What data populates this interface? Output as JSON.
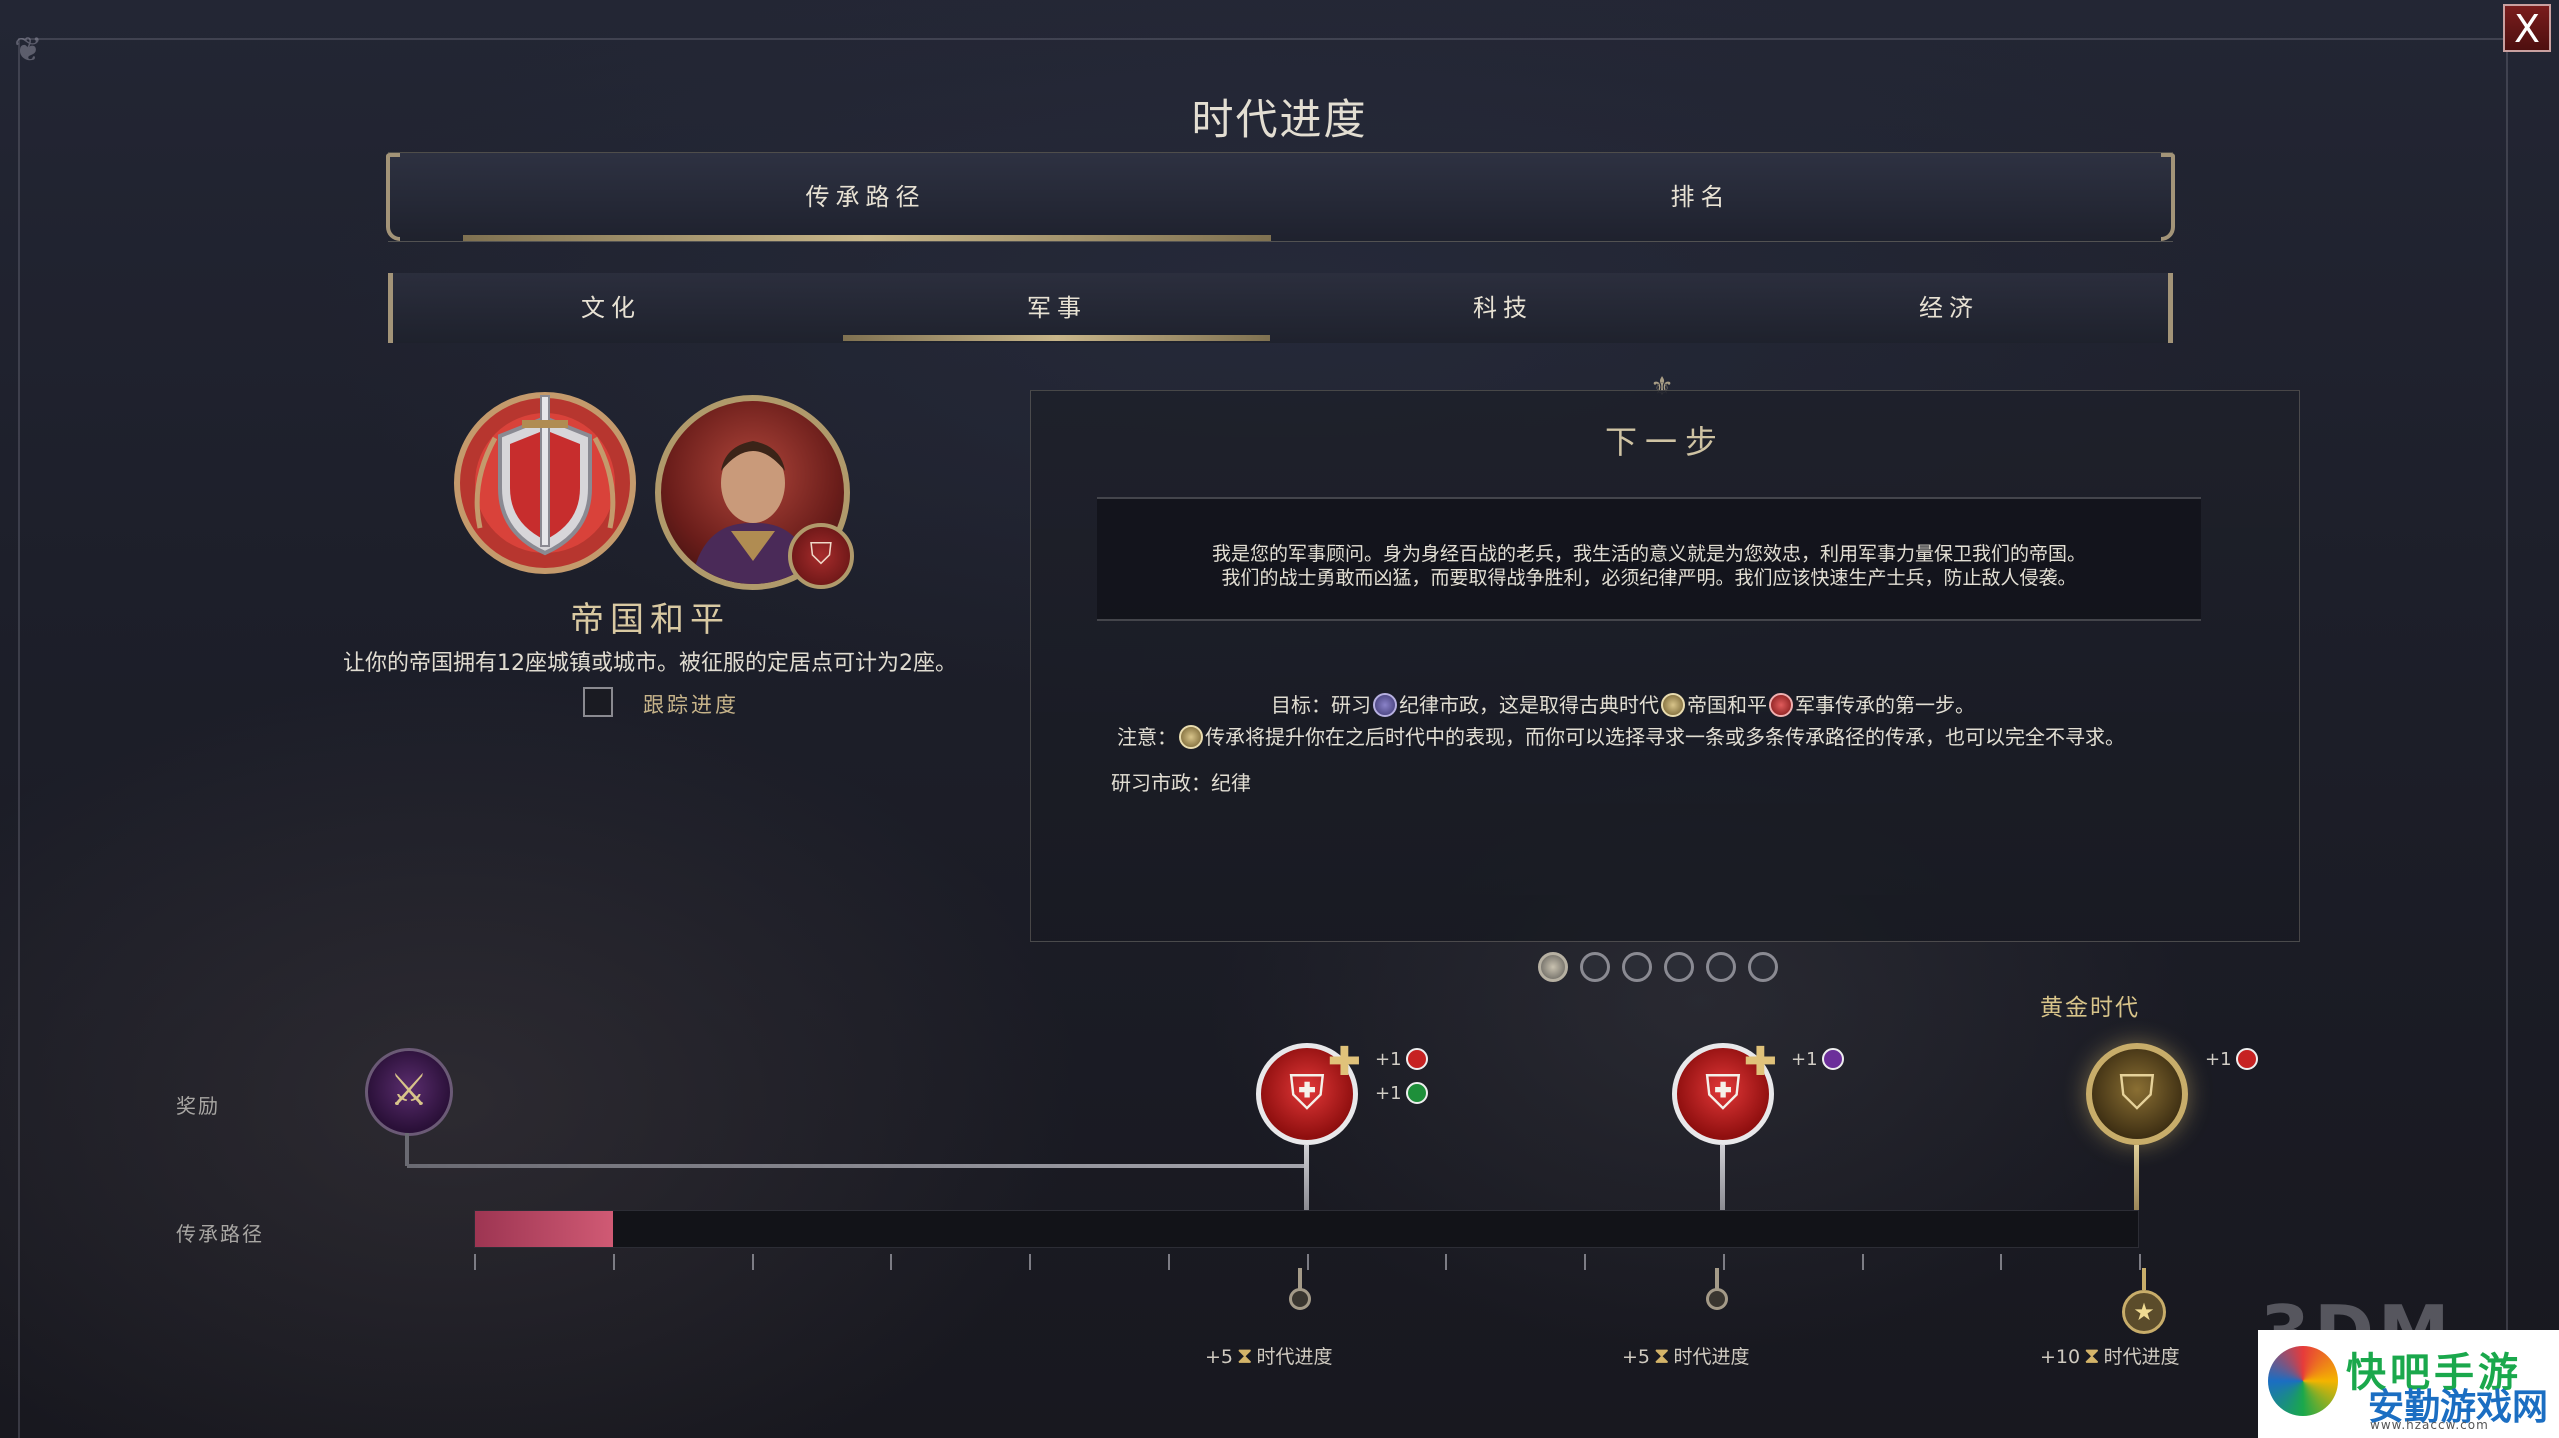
{
  "window": {
    "title": "时代进度",
    "close_label": "X"
  },
  "primary_tabs": [
    {
      "label": "传承路径",
      "active": true
    },
    {
      "label": "排名",
      "active": false
    }
  ],
  "category_tabs": [
    {
      "label": "文化",
      "active": false
    },
    {
      "label": "军事",
      "active": true
    },
    {
      "label": "科技",
      "active": false
    },
    {
      "label": "经济",
      "active": false
    }
  ],
  "legacy": {
    "name": "帝国和平",
    "description": "让你的帝国拥有12座城镇或城市。被征服的定居点可计为2座。",
    "track_label": "跟踪进度",
    "tracked": false
  },
  "next_step": {
    "title": "下一步",
    "quote_line1": "我是您的军事顾问。身为身经百战的老兵，我生活的意义就是为您效忠，利用军事力量保卫我们的帝国。",
    "quote_line2": "我们的战士勇敢而凶猛，而要取得战争胜利，必须纪律严明。我们应该快速生产士兵，防止敌人侵袭。",
    "goal_prefix": "目标：研习",
    "goal_civic": "纪律市政",
    "goal_mid": "，这是取得古典时代",
    "goal_legacy": "帝国和平",
    "goal_suffix": "军事传承的第一步。",
    "note_prefix": "注意：",
    "note_text": "传承将提升你在之后时代中的表现，而你可以选择寻求一条或多条传承路径的传承，也可以完全不寻求。",
    "study_line": "研习市政：纪律",
    "page_count": 6,
    "current_page": 1
  },
  "track": {
    "golden_age_label": "黄金时代",
    "rewards_label": "奖励",
    "legacy_path_label": "传承路径",
    "progress": 0.083,
    "milestone_1_bonus": [
      "+1",
      "+1"
    ],
    "milestone_2_bonus": [
      "+1"
    ],
    "milestone_3_bonus": [
      "+1"
    ],
    "era_rewards": [
      {
        "amount": "+5",
        "label": "时代进度"
      },
      {
        "amount": "+5",
        "label": "时代进度"
      },
      {
        "amount": "+10",
        "label": "时代进度"
      }
    ]
  },
  "icons": {
    "start_reward": "crossed-swords-icon",
    "milestone": "soldier-head-icon",
    "golden": "golden-shield-icon",
    "era": "hourglass-icon"
  },
  "colors": {
    "accent_gold": "#c8b68a",
    "progress_fill": "#c0506b",
    "military_red": "#c62222"
  },
  "watermark": {
    "brand": "3DM",
    "site_name_top": "快吧手游",
    "site_name": "安勤游戏网",
    "url": "www.hzaccw.com"
  }
}
